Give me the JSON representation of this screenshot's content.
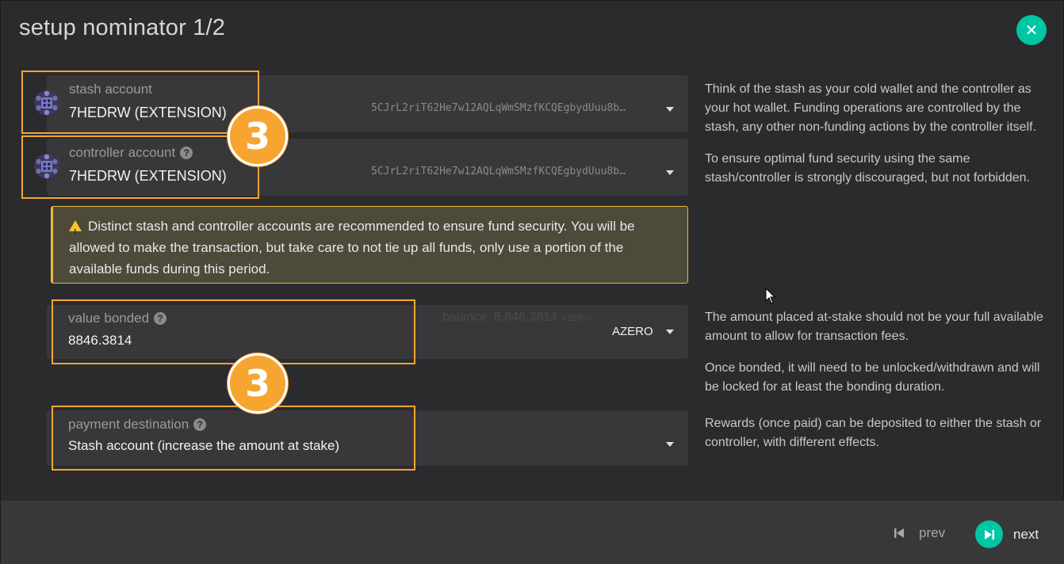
{
  "modal": {
    "title": "setup nominator 1/2",
    "close_icon": "close-icon"
  },
  "stash": {
    "label": "stash account",
    "account_name": "7HEDRW (EXTENSION)",
    "address": "5CJrL2riT62He7w12AQLqWmSMzfKCQEgbydUuu8b…"
  },
  "controller": {
    "label": "controller account",
    "account_name": "7HEDRW (EXTENSION)",
    "address": "5CJrL2riT62He7w12AQLqWmSMzfKCQEgbydUuu8b…"
  },
  "warning": {
    "text": "Distinct stash and controller accounts are recommended to ensure fund security. You will be allowed to make the transaction, but take care to not tie up all funds, only use a portion of the available funds during this period."
  },
  "value_bonded": {
    "label": "value bonded",
    "value": "8846.3814",
    "balance_label": "balance",
    "balance_value": "8,846.",
    "balance_decimals": "3814",
    "balance_unit": "AZERO",
    "unit": "AZERO"
  },
  "payment_destination": {
    "label": "payment destination",
    "value": "Stash account (increase the amount at stake)"
  },
  "help": {
    "accounts_1": "Think of the stash as your cold wallet and the controller as your hot wallet. Funding operations are controlled by the stash, any other non-funding actions by the controller itself.",
    "accounts_2": "To ensure optimal fund security using the same stash/controller is strongly discouraged, but not forbidden.",
    "bonded_1": "The amount placed at-stake should not be your full available amount to allow for transaction fees.",
    "bonded_2": "Once bonded, it will need to be unlocked/withdrawn and will be locked for at least the bonding duration.",
    "destination_1": "Rewards (once paid) can be deposited to either the stash or controller, with different effects."
  },
  "annotations": {
    "badge_1": "3",
    "badge_2": "3",
    "highlight_color": "#f7a531"
  },
  "footer": {
    "prev_label": "prev",
    "next_label": "next"
  },
  "colors": {
    "accent": "#00c7a3",
    "warning_border": "#e9b93b"
  }
}
